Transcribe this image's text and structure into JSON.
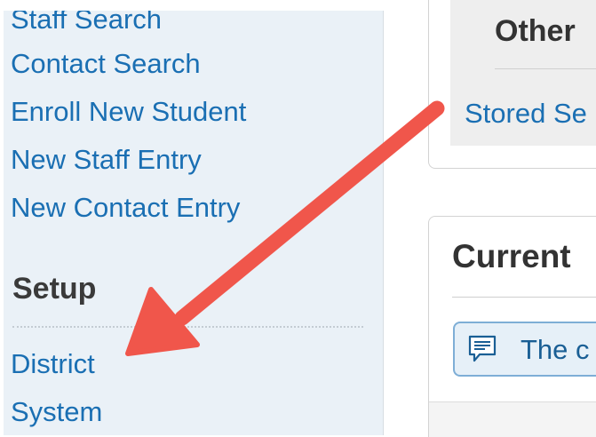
{
  "sidebar": {
    "links": [
      "Staff Search",
      "Contact Search",
      "Enroll New Student",
      "New Staff Entry",
      "New Contact Entry"
    ],
    "setup": {
      "title": "Setup",
      "links": [
        "District",
        "System"
      ]
    }
  },
  "other_panel": {
    "title": "Other",
    "link": "Stored Se"
  },
  "current_panel": {
    "title": "Current",
    "notice": "The c",
    "notice_icon": "comment-icon"
  },
  "annotation": {
    "arrow_color": "#f0564b"
  },
  "colors": {
    "link": "#1a6fb3",
    "sidebar_bg": "#eaf1f7"
  }
}
